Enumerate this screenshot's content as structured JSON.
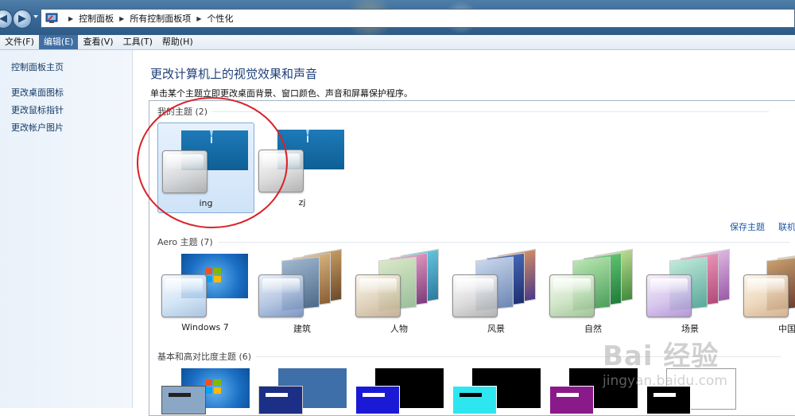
{
  "addressbar": {
    "breadcrumbs": [
      "控制面板",
      "所有控制面板项",
      "个性化"
    ]
  },
  "menubar": [
    {
      "label": "文件(F)",
      "active": false
    },
    {
      "label": "编辑(E)",
      "active": true
    },
    {
      "label": "查看(V)",
      "active": false
    },
    {
      "label": "工具(T)",
      "active": false
    },
    {
      "label": "帮助(H)",
      "active": false
    }
  ],
  "sidebar": {
    "home_link": "控制面板主页",
    "links": [
      "更改桌面图标",
      "更改鼠标指针",
      "更改帐户图片"
    ]
  },
  "main": {
    "title": "更改计算机上的视觉效果和声音",
    "subtitle": "单击某个主题立即更改桌面背景、窗口颜色、声音和屏幕保护程序。"
  },
  "my_themes": {
    "header": "我的主题 (2)",
    "themes": [
      {
        "name": "ing",
        "selected": true
      },
      {
        "name": "zj",
        "selected": false
      }
    ],
    "save_link": "保存主题",
    "online_link": "联机"
  },
  "aero_themes": {
    "header": "Aero 主题 (7)",
    "themes": [
      {
        "name": "Windows 7",
        "color": "#2f86d8"
      },
      {
        "name": "建筑",
        "color": "#7a5a3c"
      },
      {
        "name": "人物",
        "color": "#5aa9c9"
      },
      {
        "name": "风景",
        "color": "#4b5aa8"
      },
      {
        "name": "自然",
        "color": "#3f9d4a"
      },
      {
        "name": "场景",
        "color": "#b36fc9"
      },
      {
        "name": "中国",
        "color": "#c98a3a"
      }
    ]
  },
  "basic_themes": {
    "header": "基本和高对比度主题 (6)",
    "items": [
      {
        "bg": "#2f86d8",
        "accent": "#8aa7c6"
      },
      {
        "bg": "#3f6fa8",
        "accent": "#1b2f86"
      },
      {
        "bg": "#000000",
        "accent": "#1a1ad6"
      },
      {
        "bg": "#000000",
        "accent": "#2ee6f0"
      },
      {
        "bg": "#000000",
        "accent": "#8a1a8a"
      },
      {
        "bg": "#ffffff",
        "accent": "#000000"
      }
    ]
  },
  "watermark": {
    "brand": "Bai 经验",
    "url": "jingyan.baidu.com"
  },
  "colors": {
    "title_blue": "#1e3f78",
    "link_blue": "#1c58a8",
    "selection_border": "#84acd6",
    "annotation_red": "#d8232a"
  }
}
